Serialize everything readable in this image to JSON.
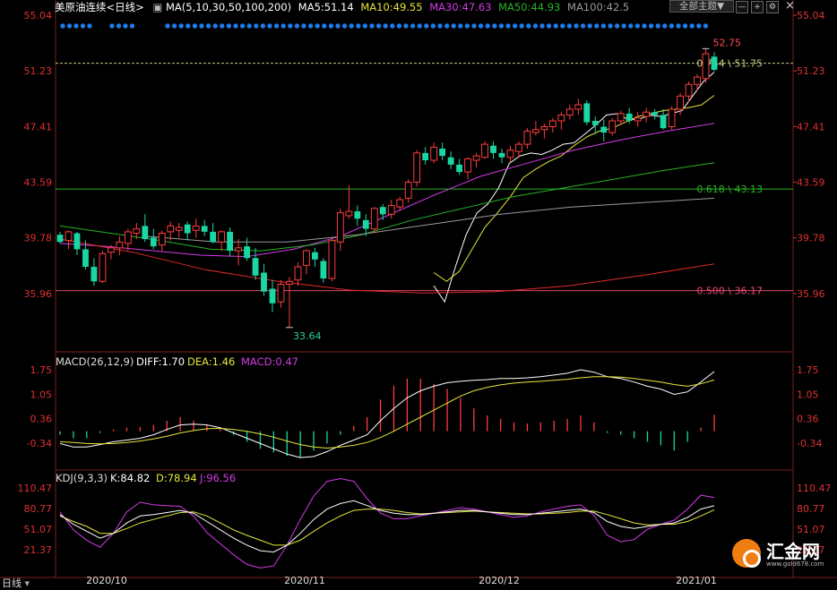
{
  "header": {
    "symbol": "美原油连续",
    "period": "<日线>",
    "ma_params": "MA(5,10,30,50,100,200)",
    "ma5": "MA5:51.14",
    "ma10": "MA10:49.55",
    "ma30": "MA30:47.63",
    "ma50": "MA50:44.93",
    "ma100": "MA100:42.5",
    "indicator_button": "全部主题",
    "button_arrow": "▼",
    "window_close": "×"
  },
  "colors": {
    "up": "#ff3d3d",
    "down": "#19d6a2",
    "ma5": "#ffffff",
    "ma10": "#e6e63c",
    "ma30": "#d23ce6",
    "ma50": "#27b427",
    "ma100": "#9a9a9a",
    "ma200": "#e02a2a"
  },
  "chart_data": [
    {
      "type": "candlestick",
      "y_ticks": [
        "55.04",
        "51.23",
        "47.41",
        "43.59",
        "39.78",
        "35.96"
      ],
      "ylim": [
        33.2,
        55.04
      ],
      "x_labels": [
        "2020/10",
        "2020/11",
        "2020/12",
        "2021/01"
      ],
      "annotations": [
        {
          "text": "52.75",
          "price": 52.75,
          "kind": "high"
        },
        {
          "text": "33.64",
          "price": 33.64,
          "kind": "low"
        }
      ],
      "levels": [
        {
          "label": "0.764 \\ 51.75",
          "price": 51.75,
          "color": "#c8c880",
          "style": "dashed"
        },
        {
          "label": "0.618 \\ 43.13",
          "price": 43.13,
          "color": "#27b427",
          "style": "solid"
        },
        {
          "label": "0.500 \\ 36.17",
          "price": 36.17,
          "color": "#e24a6a",
          "style": "solid"
        }
      ],
      "ohlc": [
        [
          40.0,
          40.2,
          39.4,
          39.5
        ],
        [
          39.6,
          40.3,
          39.0,
          40.2
        ],
        [
          40.1,
          40.2,
          38.6,
          39.0
        ],
        [
          39.0,
          39.6,
          37.6,
          37.8
        ],
        [
          37.8,
          38.4,
          36.5,
          36.8
        ],
        [
          36.8,
          38.9,
          36.7,
          38.7
        ],
        [
          38.8,
          39.3,
          38.3,
          39.1
        ],
        [
          39.1,
          39.9,
          38.6,
          39.5
        ],
        [
          39.4,
          40.4,
          38.9,
          40.2
        ],
        [
          40.1,
          40.8,
          39.7,
          40.4
        ],
        [
          40.6,
          41.4,
          39.5,
          39.7
        ],
        [
          39.8,
          40.4,
          39.0,
          39.2
        ],
        [
          39.3,
          40.3,
          38.9,
          40.1
        ],
        [
          40.2,
          40.9,
          39.6,
          40.6
        ],
        [
          40.3,
          40.8,
          39.8,
          40.5
        ],
        [
          40.7,
          40.9,
          39.6,
          40.1
        ],
        [
          40.3,
          41.1,
          39.8,
          40.6
        ],
        [
          40.6,
          41.0,
          39.9,
          40.2
        ],
        [
          40.2,
          40.8,
          39.4,
          39.5
        ],
        [
          39.5,
          40.3,
          38.9,
          40.2
        ],
        [
          40.2,
          40.5,
          38.5,
          38.9
        ],
        [
          38.9,
          39.7,
          37.9,
          39.1
        ],
        [
          39.2,
          39.8,
          38.2,
          38.4
        ],
        [
          38.4,
          39.1,
          36.9,
          37.2
        ],
        [
          37.4,
          38.0,
          35.8,
          36.1
        ],
        [
          36.3,
          36.9,
          34.7,
          35.3
        ],
        [
          35.4,
          36.9,
          35.0,
          36.6
        ],
        [
          36.6,
          37.1,
          33.64,
          36.8
        ],
        [
          36.9,
          38.1,
          36.5,
          37.8
        ],
        [
          37.9,
          39.0,
          37.3,
          38.9
        ],
        [
          38.8,
          39.1,
          37.8,
          38.3
        ],
        [
          38.2,
          38.4,
          36.7,
          37.0
        ],
        [
          37.0,
          39.8,
          36.8,
          39.6
        ],
        [
          39.5,
          41.8,
          38.9,
          41.5
        ],
        [
          41.3,
          43.4,
          41.1,
          41.6
        ],
        [
          41.6,
          42.0,
          40.6,
          41.1
        ],
        [
          41.0,
          41.4,
          39.9,
          40.4
        ],
        [
          40.4,
          41.9,
          40.1,
          41.8
        ],
        [
          41.9,
          42.1,
          41.0,
          41.4
        ],
        [
          41.4,
          42.4,
          41.1,
          42.0
        ],
        [
          41.9,
          42.6,
          41.7,
          42.4
        ],
        [
          42.5,
          43.8,
          42.2,
          43.6
        ],
        [
          43.6,
          45.8,
          43.3,
          45.6
        ],
        [
          45.6,
          46.0,
          44.8,
          45.1
        ],
        [
          45.1,
          46.3,
          44.9,
          46.0
        ],
        [
          45.9,
          46.3,
          45.1,
          45.4
        ],
        [
          45.3,
          45.7,
          44.5,
          44.8
        ],
        [
          44.8,
          45.2,
          44.1,
          44.3
        ],
        [
          44.3,
          45.3,
          43.8,
          45.2
        ],
        [
          45.1,
          45.6,
          44.6,
          45.4
        ],
        [
          45.3,
          46.4,
          45.2,
          46.2
        ],
        [
          46.1,
          46.4,
          45.2,
          45.6
        ],
        [
          45.6,
          45.9,
          44.9,
          45.3
        ],
        [
          45.3,
          46.1,
          45.0,
          45.8
        ],
        [
          45.7,
          46.4,
          45.3,
          46.2
        ],
        [
          46.2,
          47.3,
          45.9,
          47.1
        ],
        [
          47.0,
          47.8,
          46.8,
          47.2
        ],
        [
          47.2,
          47.6,
          46.6,
          47.4
        ],
        [
          47.4,
          48.0,
          47.0,
          47.8
        ],
        [
          47.8,
          48.4,
          47.2,
          48.2
        ],
        [
          48.2,
          48.9,
          47.9,
          48.6
        ],
        [
          48.6,
          49.3,
          48.2,
          48.9
        ],
        [
          49.0,
          49.2,
          47.5,
          47.7
        ],
        [
          47.8,
          48.1,
          46.9,
          47.5
        ],
        [
          47.4,
          47.9,
          46.4,
          47.0
        ],
        [
          47.0,
          48.0,
          46.8,
          47.8
        ],
        [
          47.8,
          48.5,
          47.5,
          48.3
        ],
        [
          48.3,
          48.7,
          47.6,
          47.8
        ],
        [
          47.8,
          48.4,
          47.4,
          48.0
        ],
        [
          48.1,
          48.7,
          47.7,
          48.4
        ],
        [
          48.4,
          48.6,
          47.9,
          48.2
        ],
        [
          48.2,
          48.6,
          47.2,
          47.3
        ],
        [
          47.4,
          48.8,
          47.2,
          48.6
        ],
        [
          48.6,
          49.7,
          48.2,
          49.5
        ],
        [
          49.5,
          50.5,
          49.1,
          50.3
        ],
        [
          50.3,
          51.0,
          49.9,
          50.8
        ],
        [
          50.7,
          52.75,
          50.4,
          52.4
        ],
        [
          52.2,
          52.5,
          51.2,
          51.3
        ]
      ],
      "ma_series": [
        {
          "name": "MA5",
          "color_key": "ma5",
          "start": 44,
          "values": [
            36.5,
            35.4,
            37.8,
            40.0,
            41.5,
            42.1,
            43.2,
            44.9,
            45.4,
            45.6,
            45.5,
            45.8,
            46.2,
            46.3,
            46.9,
            47.5,
            48.2,
            48.3,
            47.9,
            47.9,
            48.2,
            48.1,
            48.3,
            48.5,
            49.5,
            50.5,
            51.14
          ]
        },
        {
          "name": "MA10",
          "color_key": "ma10",
          "start": 44,
          "values": [
            37.4,
            36.8,
            37.5,
            39.0,
            40.5,
            41.5,
            42.6,
            43.9,
            44.5,
            45.0,
            45.4,
            46.1,
            46.7,
            47.1,
            47.3,
            47.7,
            48.1,
            48.3,
            48.5,
            48.6,
            48.7,
            48.9,
            49.55
          ]
        },
        {
          "name": "MA30",
          "color_key": "ma30",
          "start": 0,
          "values": [
            39.4,
            39.2,
            38.9,
            38.6,
            38.5,
            39.0,
            39.9,
            41.3,
            42.7,
            44.0,
            44.9,
            45.8,
            46.5,
            47.1,
            47.63
          ]
        },
        {
          "name": "MA50",
          "color_key": "ma50",
          "start": 0,
          "values": [
            40.6,
            40.1,
            39.6,
            39.0,
            38.9,
            39.3,
            40.0,
            41.0,
            41.8,
            42.6,
            43.2,
            43.8,
            44.4,
            44.93
          ]
        },
        {
          "name": "MA100",
          "color_key": "ma100",
          "start": 10,
          "values": [
            39.9,
            39.5,
            39.5,
            40.0,
            40.7,
            41.4,
            41.9,
            42.2,
            42.5
          ]
        },
        {
          "name": "MA200",
          "color_key": "ma200",
          "start": 0,
          "values": [
            39.7,
            38.8,
            37.6,
            36.8,
            36.2,
            36.0,
            36.1,
            36.5,
            37.2,
            38.0
          ]
        }
      ]
    },
    {
      "type": "macd",
      "label": "MACD(26,12,9)",
      "diff": "DIFF:1.70",
      "dea": "DEA:1.46",
      "macd": "MACD:0.47",
      "y_ticks": [
        "1.75",
        "1.05",
        "0.36",
        "-0.34"
      ],
      "ylim": [
        -1.05,
        2.05
      ],
      "diff_values": [
        -0.35,
        -0.45,
        -0.45,
        -0.38,
        -0.3,
        -0.25,
        -0.2,
        -0.1,
        0.05,
        0.18,
        0.2,
        0.18,
        0.1,
        -0.05,
        -0.2,
        -0.35,
        -0.5,
        -0.65,
        -0.75,
        -0.72,
        -0.58,
        -0.4,
        -0.25,
        -0.1,
        0.3,
        0.65,
        0.95,
        1.15,
        1.28,
        1.38,
        1.42,
        1.45,
        1.47,
        1.5,
        1.5,
        1.52,
        1.55,
        1.6,
        1.65,
        1.75,
        1.68,
        1.55,
        1.5,
        1.4,
        1.28,
        1.2,
        1.05,
        1.12,
        1.4,
        1.7
      ],
      "dea_values": [
        -0.3,
        -0.32,
        -0.35,
        -0.36,
        -0.35,
        -0.32,
        -0.28,
        -0.22,
        -0.14,
        -0.05,
        0.02,
        0.07,
        0.08,
        0.05,
        0.0,
        -0.08,
        -0.17,
        -0.28,
        -0.38,
        -0.45,
        -0.48,
        -0.45,
        -0.4,
        -0.32,
        -0.18,
        0.0,
        0.2,
        0.4,
        0.6,
        0.8,
        1.0,
        1.15,
        1.25,
        1.32,
        1.37,
        1.4,
        1.42,
        1.45,
        1.48,
        1.52,
        1.55,
        1.55,
        1.54,
        1.5,
        1.45,
        1.4,
        1.33,
        1.28,
        1.35,
        1.46
      ],
      "hist_values": [
        -0.1,
        -0.2,
        -0.2,
        -0.05,
        0.05,
        0.1,
        0.12,
        0.18,
        0.3,
        0.4,
        0.3,
        0.2,
        0.05,
        -0.1,
        -0.3,
        -0.5,
        -0.6,
        -0.7,
        -0.75,
        -0.55,
        -0.35,
        -0.1,
        0.15,
        0.4,
        0.9,
        1.3,
        1.5,
        1.5,
        1.35,
        1.2,
        0.95,
        0.65,
        0.45,
        0.35,
        0.25,
        0.22,
        0.25,
        0.3,
        0.35,
        0.45,
        0.25,
        -0.05,
        -0.1,
        -0.2,
        -0.3,
        -0.4,
        -0.55,
        -0.3,
        0.1,
        0.47
      ]
    },
    {
      "type": "kdj",
      "label": "KDJ(9,3,3)",
      "k": "K:84.82",
      "d": "D:78.94",
      "j": "J:96.56",
      "y_ticks": [
        "110.47",
        "80.77",
        "51.07",
        "21.37"
      ],
      "ylim": [
        0,
        125
      ],
      "k_values": [
        72,
        58,
        48,
        38,
        45,
        60,
        70,
        72,
        75,
        78,
        74,
        62,
        50,
        38,
        28,
        20,
        18,
        28,
        45,
        65,
        80,
        88,
        92,
        85,
        78,
        74,
        72,
        72,
        74,
        76,
        78,
        78,
        76,
        74,
        72,
        72,
        74,
        76,
        78,
        80,
        75,
        62,
        55,
        52,
        55,
        58,
        60,
        68,
        80,
        84.82
      ],
      "d_values": [
        70,
        62,
        55,
        45,
        45,
        52,
        60,
        65,
        70,
        75,
        76,
        70,
        60,
        50,
        42,
        35,
        28,
        28,
        35,
        48,
        60,
        70,
        78,
        80,
        80,
        78,
        75,
        73,
        74,
        75,
        76,
        77,
        76,
        75,
        74,
        73,
        73,
        74,
        75,
        77,
        77,
        72,
        66,
        60,
        57,
        58,
        58,
        62,
        70,
        78.94
      ],
      "j_values": [
        76,
        50,
        35,
        25,
        45,
        76,
        90,
        86,
        85,
        84,
        70,
        46,
        30,
        14,
        0,
        -5,
        -2,
        28,
        65,
        99,
        120,
        124,
        120,
        95,
        74,
        66,
        66,
        70,
        74,
        78,
        82,
        80,
        76,
        72,
        68,
        70,
        76,
        80,
        84,
        86,
        71,
        42,
        33,
        36,
        51,
        58,
        64,
        80,
        100,
        96.56
      ]
    }
  ]
}
